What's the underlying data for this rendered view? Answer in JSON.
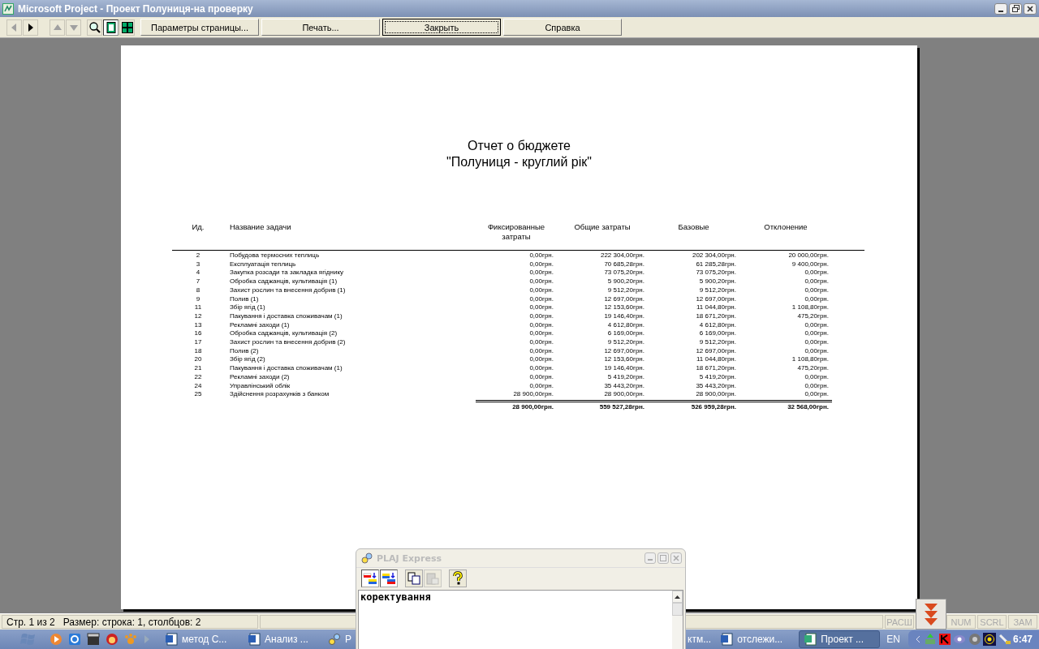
{
  "window": {
    "title": "Microsoft Project - Проект Полуниця-на проверку"
  },
  "toolbar": {
    "nav": [
      {
        "kind": "back",
        "disabled": true
      },
      {
        "kind": "forward",
        "disabled": false
      },
      {
        "kind": "up",
        "disabled": true
      },
      {
        "kind": "down",
        "disabled": true
      }
    ],
    "views": [
      {
        "kind": "zoom",
        "selected": false
      },
      {
        "kind": "one-page",
        "selected": true
      },
      {
        "kind": "multi-page",
        "selected": false
      }
    ],
    "buttons": [
      {
        "label": "Параметры страницы...",
        "focused": false
      },
      {
        "label": "Печать...",
        "focused": false
      },
      {
        "label": "Закрыть",
        "focused": true
      },
      {
        "label": "Справка",
        "focused": false
      }
    ]
  },
  "report": {
    "title": "Отчет о бюджете",
    "subtitle": "\"Полуниця - круглий рік\"",
    "columns": [
      "Ид.",
      "Название задачи",
      "Фиксированные затраты",
      "Общие затраты",
      "Базовые",
      "Отклонение"
    ],
    "rows": [
      {
        "id": "2",
        "name": "Побудова термосних теплиць",
        "fixed": "0,00грн.",
        "total": "222 304,00грн.",
        "baseline": "202 304,00грн.",
        "variance": "20 000,00грн."
      },
      {
        "id": "3",
        "name": "Експлуатація теплиць",
        "fixed": "0,00грн.",
        "total": "70 685,28грн.",
        "baseline": "61 285,28грн.",
        "variance": "9 400,00грн."
      },
      {
        "id": "4",
        "name": "Закупка розсади та закладка ягіднику",
        "fixed": "0,00грн.",
        "total": "73 075,20грн.",
        "baseline": "73 075,20грн.",
        "variance": "0,00грн."
      },
      {
        "id": "7",
        "name": "Обробка саджанців, культивація (1)",
        "fixed": "0,00грн.",
        "total": "5 900,20грн.",
        "baseline": "5 900,20грн.",
        "variance": "0,00грн."
      },
      {
        "id": "8",
        "name": "Захист рослин та внесення добрив (1)",
        "fixed": "0,00грн.",
        "total": "9 512,20грн.",
        "baseline": "9 512,20грн.",
        "variance": "0,00грн."
      },
      {
        "id": "9",
        "name": "Полив (1)",
        "fixed": "0,00грн.",
        "total": "12 697,00грн.",
        "baseline": "12 697,00грн.",
        "variance": "0,00грн."
      },
      {
        "id": "11",
        "name": "Збір ягід (1)",
        "fixed": "0,00грн.",
        "total": "12 153,60грн.",
        "baseline": "11 044,80грн.",
        "variance": "1 108,80грн."
      },
      {
        "id": "12",
        "name": "Пакування і доставка споживачам (1)",
        "fixed": "0,00грн.",
        "total": "19 146,40грн.",
        "baseline": "18 671,20грн.",
        "variance": "475,20грн."
      },
      {
        "id": "13",
        "name": "Рекламні заходи (1)",
        "fixed": "0,00грн.",
        "total": "4 612,80грн.",
        "baseline": "4 612,80грн.",
        "variance": "0,00грн."
      },
      {
        "id": "16",
        "name": "Обробка саджанців, культивація (2)",
        "fixed": "0,00грн.",
        "total": "6 169,00грн.",
        "baseline": "6 169,00грн.",
        "variance": "0,00грн."
      },
      {
        "id": "17",
        "name": "Захист рослин та внесення добрив (2)",
        "fixed": "0,00грн.",
        "total": "9 512,20грн.",
        "baseline": "9 512,20грн.",
        "variance": "0,00грн."
      },
      {
        "id": "18",
        "name": "Полив (2)",
        "fixed": "0,00грн.",
        "total": "12 697,00грн.",
        "baseline": "12 697,00грн.",
        "variance": "0,00грн."
      },
      {
        "id": "20",
        "name": "Збір ягід (2)",
        "fixed": "0,00грн.",
        "total": "12 153,60грн.",
        "baseline": "11 044,80грн.",
        "variance": "1 108,80грн."
      },
      {
        "id": "21",
        "name": "Пакування і доставка споживачам (1)",
        "fixed": "0,00грн.",
        "total": "19 146,40грн.",
        "baseline": "18 671,20грн.",
        "variance": "475,20грн."
      },
      {
        "id": "22",
        "name": "Рекламні заходи (2)",
        "fixed": "0,00грн.",
        "total": "5 419,20грн.",
        "baseline": "5 419,20грн.",
        "variance": "0,00грн."
      },
      {
        "id": "24",
        "name": "Управлінський облік",
        "fixed": "0,00грн.",
        "total": "35 443,20грн.",
        "baseline": "35 443,20грн.",
        "variance": "0,00грн."
      },
      {
        "id": "25",
        "name": "Здійснення розрахунків з банком",
        "fixed": "28 900,00грн.",
        "total": "28 900,00грн.",
        "baseline": "28 900,00грн.",
        "variance": "0,00грн."
      }
    ],
    "totals": {
      "fixed": "28 900,00грн.",
      "total": "559 527,28грн.",
      "baseline": "526 959,28грн.",
      "variance": "32 568,00грн."
    }
  },
  "status_bar": {
    "text": "Стр. 1 из 2   Размер: строка: 1, столбцов: 2",
    "indicators": [
      {
        "label": "РАСШ",
        "on": false
      },
      {
        "label": "NUM",
        "on": false
      },
      {
        "label": "SCRL",
        "on": false
      },
      {
        "label": "ЗАМ",
        "on": false
      }
    ]
  },
  "plaj": {
    "title": "PLAJ Express",
    "tools": [
      {
        "kind": "ru-uk",
        "pressed": true,
        "disabled": false
      },
      {
        "kind": "uk-ru",
        "pressed": true,
        "disabled": false
      },
      {
        "kind": "copy",
        "pressed": false,
        "disabled": false
      },
      {
        "kind": "paste",
        "pressed": false,
        "disabled": true
      },
      {
        "kind": "help",
        "pressed": false,
        "disabled": false
      }
    ],
    "text": "коректування"
  },
  "taskbar": {
    "items": [
      {
        "kind": "word",
        "label": "метод С...",
        "active": false
      },
      {
        "kind": "word",
        "label": "Анализ ...",
        "active": false
      },
      {
        "kind": "plaj",
        "label": "P",
        "active": false
      },
      {
        "kind": "none",
        "label": "ктм...",
        "active": false
      },
      {
        "kind": "word",
        "label": "отслежи...",
        "active": false
      },
      {
        "kind": "project",
        "label": "Проект ...",
        "active": true
      }
    ],
    "language": "EN",
    "clock": "6:47"
  }
}
